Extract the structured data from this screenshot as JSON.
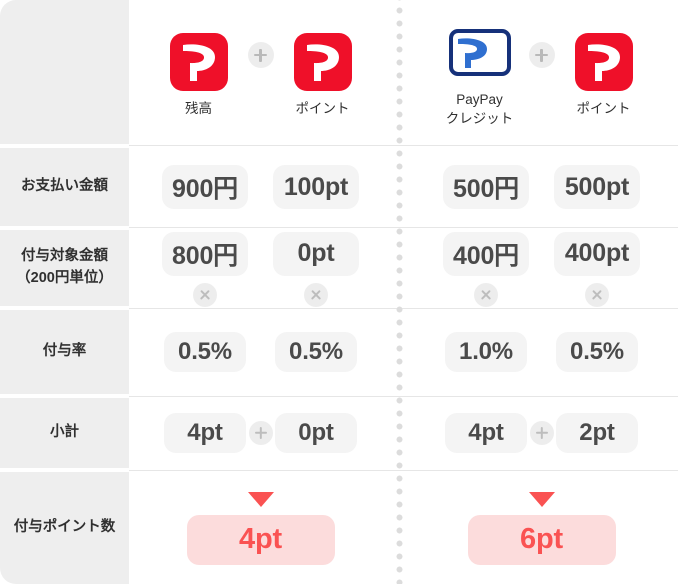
{
  "header": {
    "groups": [
      {
        "name": "paypay-balance-group",
        "items": [
          {
            "icon": "paypay-logo-icon",
            "caption": "残高"
          },
          {
            "icon": "paypay-logo-icon",
            "caption": "ポイント"
          }
        ],
        "operator": "+"
      },
      {
        "name": "paypay-credit-group",
        "items": [
          {
            "icon": "paypay-credit-card-icon",
            "caption": "PayPay\nクレジット"
          },
          {
            "icon": "paypay-logo-icon",
            "caption": "ポイント"
          }
        ],
        "operator": "+"
      }
    ]
  },
  "rows": [
    {
      "key": "payment-amount",
      "label": "お支払い金額",
      "label_line2": "",
      "values": [
        "900円",
        "100pt",
        "500円",
        "500pt"
      ],
      "operators": [
        "",
        "",
        "",
        ""
      ],
      "mid_operator": ""
    },
    {
      "key": "eligible-amount",
      "label": "付与対象金額",
      "label_line2": "（200円単位）",
      "values": [
        "800円",
        "0pt",
        "400円",
        "400pt"
      ],
      "operators": [
        "×",
        "×",
        "×",
        "×"
      ],
      "mid_operator": ""
    },
    {
      "key": "grant-rate",
      "label": "付与率",
      "label_line2": "",
      "values": [
        "0.5%",
        "0.5%",
        "1.0%",
        "0.5%"
      ],
      "operators": [
        "",
        "",
        "",
        ""
      ],
      "mid_operator": ""
    },
    {
      "key": "subtotal",
      "label": "小計",
      "label_line2": "",
      "values": [
        "4pt",
        "0pt",
        "4pt",
        "2pt"
      ],
      "operators": [
        "",
        "",
        "",
        ""
      ],
      "mid_operator": "+"
    }
  ],
  "total_row": {
    "key": "granted-points",
    "label": "付与ポイント数",
    "arrow": "arrow-down-icon",
    "values": [
      "4pt",
      "6pt"
    ]
  },
  "colors": {
    "paypay_red": "#ef1029",
    "accent_red": "#fa5252",
    "result_pill_bg": "#fcdcdc",
    "pill_bg": "#f4f4f4",
    "label_bg": "#eeeeee",
    "credit_navy": "#16317a",
    "credit_blue": "#2f6fd0"
  }
}
